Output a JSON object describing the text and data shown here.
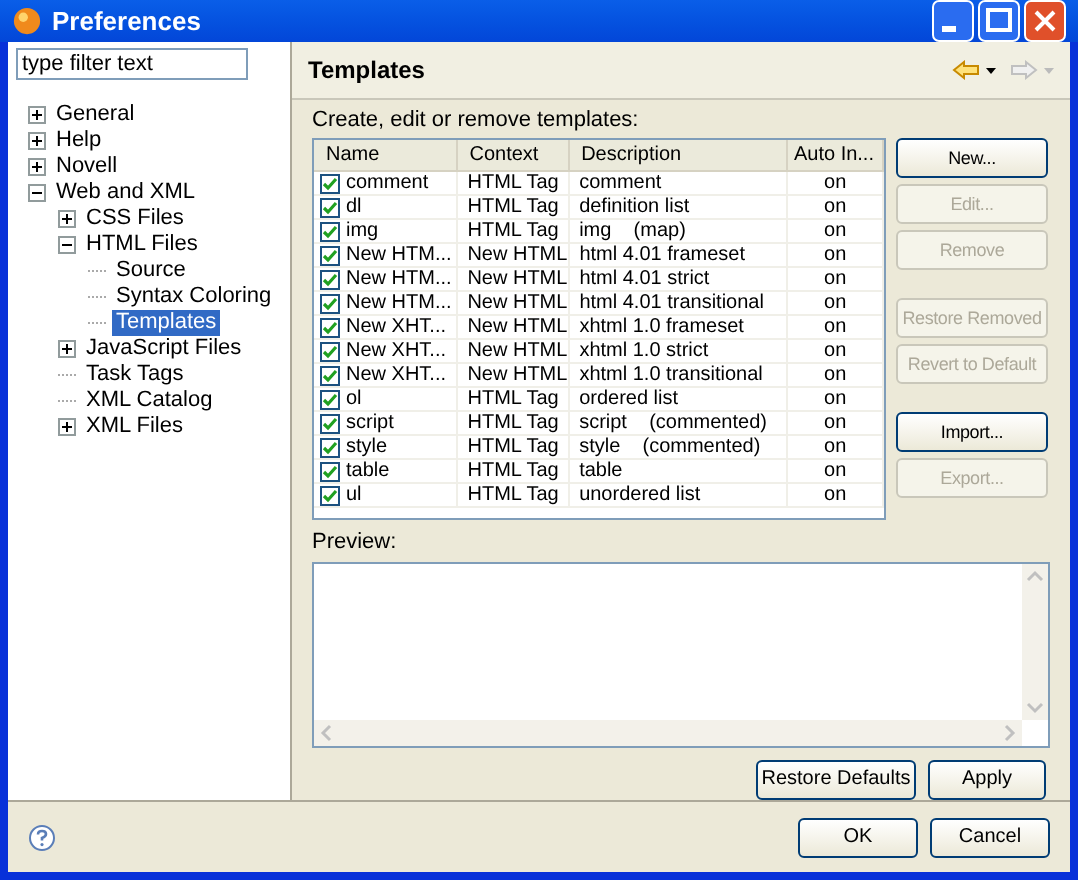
{
  "window": {
    "title": "Preferences"
  },
  "filter": {
    "placeholder": "type filter text"
  },
  "tree": [
    {
      "label": "General",
      "kind": "folder",
      "expanded": false,
      "selected": false
    },
    {
      "label": "Help",
      "kind": "folder",
      "expanded": false,
      "selected": false
    },
    {
      "label": "Novell",
      "kind": "folder",
      "expanded": false,
      "selected": false
    },
    {
      "label": "Web and XML",
      "kind": "folder",
      "expanded": true,
      "selected": false,
      "children": [
        {
          "label": "CSS Files",
          "kind": "folder",
          "expanded": false,
          "selected": false
        },
        {
          "label": "HTML Files",
          "kind": "folder",
          "expanded": true,
          "selected": false,
          "children": [
            {
              "label": "Source",
              "kind": "page",
              "selected": false
            },
            {
              "label": "Syntax Coloring",
              "kind": "page",
              "selected": false
            },
            {
              "label": "Templates",
              "kind": "page",
              "selected": true
            }
          ]
        },
        {
          "label": "JavaScript Files",
          "kind": "folder",
          "expanded": false,
          "selected": false
        },
        {
          "label": "Task Tags",
          "kind": "page",
          "selected": false
        },
        {
          "label": "XML Catalog",
          "kind": "page",
          "selected": false
        },
        {
          "label": "XML Files",
          "kind": "folder",
          "expanded": false,
          "selected": false
        }
      ]
    }
  ],
  "page": {
    "title": "Templates",
    "description": "Create, edit or remove templates:"
  },
  "table": {
    "columns": [
      "Name",
      "Context",
      "Description",
      "Auto In..."
    ],
    "rows": [
      {
        "checked": true,
        "cells": [
          "comment",
          "HTML Tag",
          "comment",
          "on"
        ]
      },
      {
        "checked": true,
        "cells": [
          "dl",
          "HTML Tag",
          "definition list",
          "on"
        ]
      },
      {
        "checked": true,
        "cells": [
          "img",
          "HTML Tag",
          "img    (map)",
          "on"
        ]
      },
      {
        "checked": true,
        "cells": [
          "New HTM...",
          "New HTML",
          "html 4.01 frameset",
          "on"
        ]
      },
      {
        "checked": true,
        "cells": [
          "New HTM...",
          "New HTML",
          "html 4.01 strict",
          "on"
        ]
      },
      {
        "checked": true,
        "cells": [
          "New HTM...",
          "New HTML",
          "html 4.01 transitional",
          "on"
        ]
      },
      {
        "checked": true,
        "cells": [
          "New XHT...",
          "New HTML",
          "xhtml 1.0 frameset",
          "on"
        ]
      },
      {
        "checked": true,
        "cells": [
          "New XHT...",
          "New HTML",
          "xhtml 1.0 strict",
          "on"
        ]
      },
      {
        "checked": true,
        "cells": [
          "New XHT...",
          "New HTML",
          "xhtml 1.0 transitional",
          "on"
        ]
      },
      {
        "checked": true,
        "cells": [
          "ol",
          "HTML Tag",
          "ordered list",
          "on"
        ]
      },
      {
        "checked": true,
        "cells": [
          "script",
          "HTML Tag",
          "script    (commented)",
          "on"
        ]
      },
      {
        "checked": true,
        "cells": [
          "style",
          "HTML Tag",
          "style    (commented)",
          "on"
        ]
      },
      {
        "checked": true,
        "cells": [
          "table",
          "HTML Tag",
          "table",
          "on"
        ]
      },
      {
        "checked": true,
        "cells": [
          "ul",
          "HTML Tag",
          "unordered list",
          "on"
        ]
      }
    ]
  },
  "side_button_groups": [
    [
      {
        "label": "New...",
        "disabled": false
      },
      {
        "label": "Edit...",
        "disabled": true
      },
      {
        "label": "Remove",
        "disabled": true
      }
    ],
    [
      {
        "label": "Restore Removed",
        "disabled": true
      },
      {
        "label": "Revert to Default",
        "disabled": true
      }
    ],
    [
      {
        "label": "Import...",
        "disabled": false
      },
      {
        "label": "Export...",
        "disabled": true
      }
    ]
  ],
  "preview": {
    "label": "Preview:"
  },
  "page_buttons": [
    "Restore Defaults",
    "Apply"
  ],
  "dialog_buttons": [
    "OK",
    "Cancel"
  ]
}
